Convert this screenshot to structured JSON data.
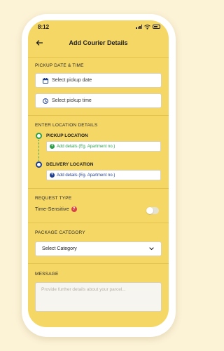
{
  "status_bar": {
    "time": "8:12"
  },
  "app_bar": {
    "title": "Add Courier Details"
  },
  "pickup": {
    "section_label": "PICKUP DATE & TIME",
    "date_placeholder": "Select pickup date",
    "time_placeholder": "Select pickup time"
  },
  "location": {
    "section_label": "ENTER LOCATION DETAILS",
    "pickup_title": "PICKUP LOCATION",
    "pickup_add": "Add details (Eg. Apartment no.)",
    "delivery_title": "DELIVERY LOCATION",
    "delivery_add": "Add details (Eg. Apartment no.)"
  },
  "request": {
    "section_label": "REQUEST TYPE",
    "option_label": "Time-Sensitive",
    "help_glyph": "?",
    "toggle_on": false
  },
  "package": {
    "section_label": "PACKAGE CATEGORY",
    "selected": "Select Category"
  },
  "message": {
    "section_label": "MESSAGE",
    "placeholder": "Provide further details about your parcel..."
  },
  "colors": {
    "background": "#fcf2d6",
    "screen": "#f5d766",
    "green": "#2e9e4a",
    "blue": "#1f3f8f",
    "help": "#d64545"
  }
}
